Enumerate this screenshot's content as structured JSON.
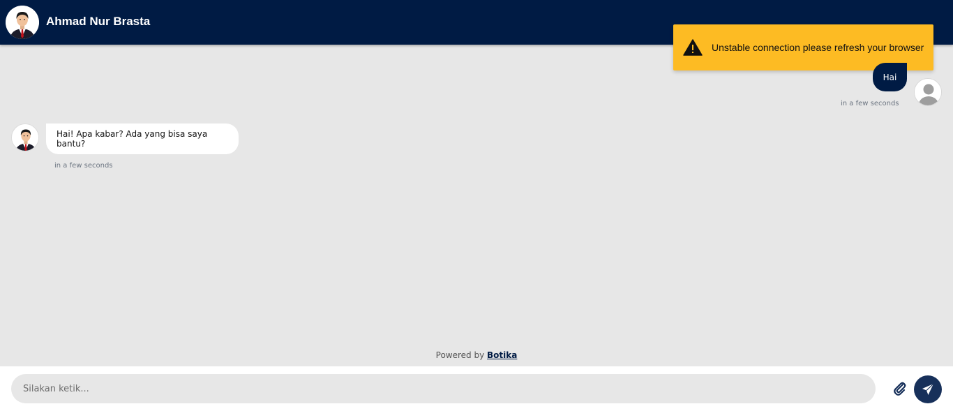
{
  "header": {
    "title": "Ahmad Nur Brasta",
    "avatar_icon": "agent-avatar-icon",
    "background": "#001b44"
  },
  "toast": {
    "message": "Unstable connection please refresh your browser",
    "icon": "warning-icon",
    "background": "#fdbb23"
  },
  "messages": [
    {
      "sender": "user",
      "text": "Hai",
      "time": "in a few seconds",
      "avatar_icon": "user-placeholder-icon"
    },
    {
      "sender": "bot",
      "text": "Hai! Apa kabar? Ada yang bisa saya bantu?",
      "time": "in a few seconds",
      "avatar_icon": "agent-avatar-icon"
    }
  ],
  "footer": {
    "powered_prefix": "Powered by",
    "powered_brand": "Botika",
    "input_placeholder": "Silakan ketik...",
    "attach_icon": "paperclip-icon",
    "send_icon": "send-icon"
  }
}
